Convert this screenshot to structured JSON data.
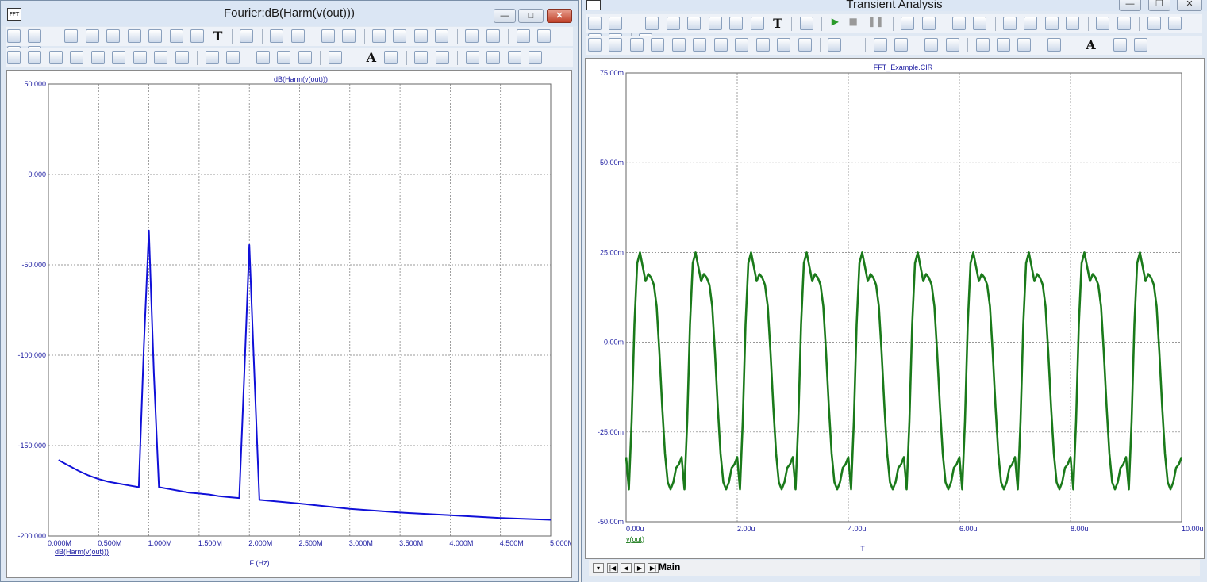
{
  "fft_window": {
    "title": "Fourier:dB(Harm(v(out)))",
    "icon_label": "FFT",
    "plot": {
      "title": "dB(Harm(v(out)))",
      "xlabel": "F (Hz)",
      "legend": "dB(Harm(v(out)))",
      "y_ticks": [
        "50.000",
        "0.000",
        "-50.000",
        "-100.000",
        "-150.000",
        "-200.000"
      ],
      "x_ticks": [
        "0.000M",
        "0.500M",
        "1.000M",
        "1.500M",
        "2.000M",
        "2.500M",
        "3.000M",
        "3.500M",
        "4.000M",
        "4.500M",
        "5.000M"
      ]
    }
  },
  "transient_window": {
    "title": "Transient Analysis",
    "plot": {
      "title": "FFT_Example.CIR",
      "xlabel": "T",
      "legend": "v(out)",
      "y_ticks": [
        "75.00m",
        "50.00m",
        "25.00m",
        "0.00m",
        "-25.00m",
        "-50.00m"
      ],
      "x_ticks": [
        "0.00u",
        "2.00u",
        "4.00u",
        "6.00u",
        "8.00u",
        "10.00u"
      ]
    },
    "tab_label": "Main"
  },
  "chart_data": [
    {
      "type": "line",
      "title": "dB(Harm(v(out)))",
      "xlabel": "F (Hz)",
      "ylabel": "",
      "xlim": [
        0,
        5.0
      ],
      "ylim": [
        -200,
        50
      ],
      "grid": true,
      "color": "#1010d8",
      "series": [
        {
          "name": "dB(Harm(v(out)))",
          "x": [
            0.1,
            0.2,
            0.3,
            0.4,
            0.5,
            0.6,
            0.7,
            0.8,
            0.9,
            0.95,
            1.0,
            1.05,
            1.1,
            1.2,
            1.3,
            1.4,
            1.5,
            1.6,
            1.7,
            1.8,
            1.9,
            1.95,
            2.0,
            2.05,
            2.1,
            2.5,
            3.0,
            3.5,
            4.0,
            4.5,
            5.0
          ],
          "y": [
            -158,
            -161,
            -164,
            -166.5,
            -168.5,
            -170,
            -171,
            -172,
            -173,
            -95,
            -31,
            -110,
            -173,
            -174,
            -175,
            -176,
            -176.5,
            -177,
            -178,
            -178.5,
            -179,
            -110,
            -39,
            -110,
            -180,
            -182,
            -185,
            -187,
            -188.5,
            -190,
            -191
          ]
        }
      ]
    },
    {
      "type": "line",
      "title": "FFT_Example.CIR",
      "xlabel": "T",
      "ylabel": "",
      "xlim": [
        0,
        10
      ],
      "ylim": [
        -0.05,
        0.075
      ],
      "grid": true,
      "color": "#1a7a1a",
      "series": [
        {
          "name": "v(out)",
          "period": 1.0,
          "x": [
            0.0,
            0.05,
            0.1,
            0.15,
            0.2,
            0.25,
            0.3,
            0.35,
            0.4,
            0.45,
            0.5,
            0.55,
            0.6,
            0.65,
            0.7,
            0.75,
            0.8,
            0.85,
            0.9,
            0.95,
            1.0
          ],
          "y": [
            -0.032,
            -0.041,
            -0.022,
            0.005,
            0.022,
            0.025,
            0.021,
            0.017,
            0.019,
            0.018,
            0.016,
            0.01,
            -0.003,
            -0.018,
            -0.031,
            -0.039,
            -0.041,
            -0.039,
            -0.035,
            -0.034,
            -0.032
          ]
        }
      ]
    }
  ]
}
